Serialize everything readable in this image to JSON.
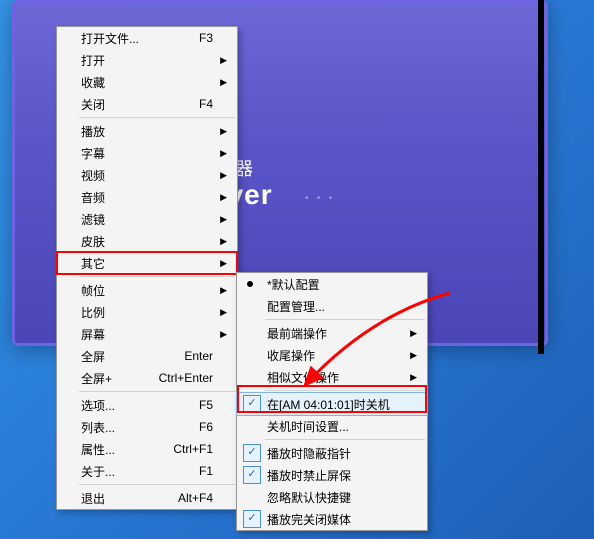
{
  "player": {
    "line1": "放器",
    "line2": "ayer"
  },
  "menu1": [
    {
      "label": "打开文件...",
      "shortcut": "F3",
      "submenu": false,
      "sep": false
    },
    {
      "label": "打开",
      "shortcut": "",
      "submenu": true,
      "sep": false
    },
    {
      "label": "收藏",
      "shortcut": "",
      "submenu": true,
      "sep": false
    },
    {
      "label": "关闭",
      "shortcut": "F4",
      "submenu": false,
      "sep": true
    },
    {
      "label": "播放",
      "shortcut": "",
      "submenu": true,
      "sep": false
    },
    {
      "label": "字幕",
      "shortcut": "",
      "submenu": true,
      "sep": false
    },
    {
      "label": "视频",
      "shortcut": "",
      "submenu": true,
      "sep": false
    },
    {
      "label": "音频",
      "shortcut": "",
      "submenu": true,
      "sep": false
    },
    {
      "label": "滤镜",
      "shortcut": "",
      "submenu": true,
      "sep": false
    },
    {
      "label": "皮肤",
      "shortcut": "",
      "submenu": true,
      "sep": false
    },
    {
      "label": "其它",
      "shortcut": "",
      "submenu": true,
      "sep": true,
      "highlight": true
    },
    {
      "label": "帧位",
      "shortcut": "",
      "submenu": true,
      "sep": false
    },
    {
      "label": "比例",
      "shortcut": "",
      "submenu": true,
      "sep": false
    },
    {
      "label": "屏幕",
      "shortcut": "",
      "submenu": true,
      "sep": false
    },
    {
      "label": "全屏",
      "shortcut": "Enter",
      "submenu": false,
      "sep": false
    },
    {
      "label": "全屏+",
      "shortcut": "Ctrl+Enter",
      "submenu": false,
      "sep": true
    },
    {
      "label": "选项...",
      "shortcut": "F5",
      "submenu": false,
      "sep": false
    },
    {
      "label": "列表...",
      "shortcut": "F6",
      "submenu": false,
      "sep": false
    },
    {
      "label": "属性...",
      "shortcut": "Ctrl+F1",
      "submenu": false,
      "sep": false
    },
    {
      "label": "关于...",
      "shortcut": "F1",
      "submenu": false,
      "sep": true
    },
    {
      "label": "退出",
      "shortcut": "Alt+F4",
      "submenu": false,
      "sep": false
    }
  ],
  "menu2": [
    {
      "label": "*默认配置",
      "submenu": false,
      "sep": false,
      "radio": true
    },
    {
      "label": "配置管理...",
      "submenu": false,
      "sep": true
    },
    {
      "label": "最前端操作",
      "submenu": true,
      "sep": false
    },
    {
      "label": "收尾操作",
      "submenu": true,
      "sep": false
    },
    {
      "label": "相似文件操作",
      "submenu": true,
      "sep": true
    },
    {
      "label": "在[AM 04:01:01]时关机",
      "submenu": false,
      "sep": false,
      "check": true,
      "hl": true
    },
    {
      "label": "关机时间设置...",
      "submenu": false,
      "sep": true
    },
    {
      "label": "播放时隐蔽指针",
      "submenu": false,
      "sep": false,
      "check": true
    },
    {
      "label": "播放时禁止屏保",
      "submenu": false,
      "sep": false,
      "check": true
    },
    {
      "label": "忽略默认快捷键",
      "submenu": false,
      "sep": false
    },
    {
      "label": "播放完关闭媒体",
      "submenu": false,
      "sep": false,
      "check": true
    }
  ],
  "annotation_color": "#ff0000"
}
